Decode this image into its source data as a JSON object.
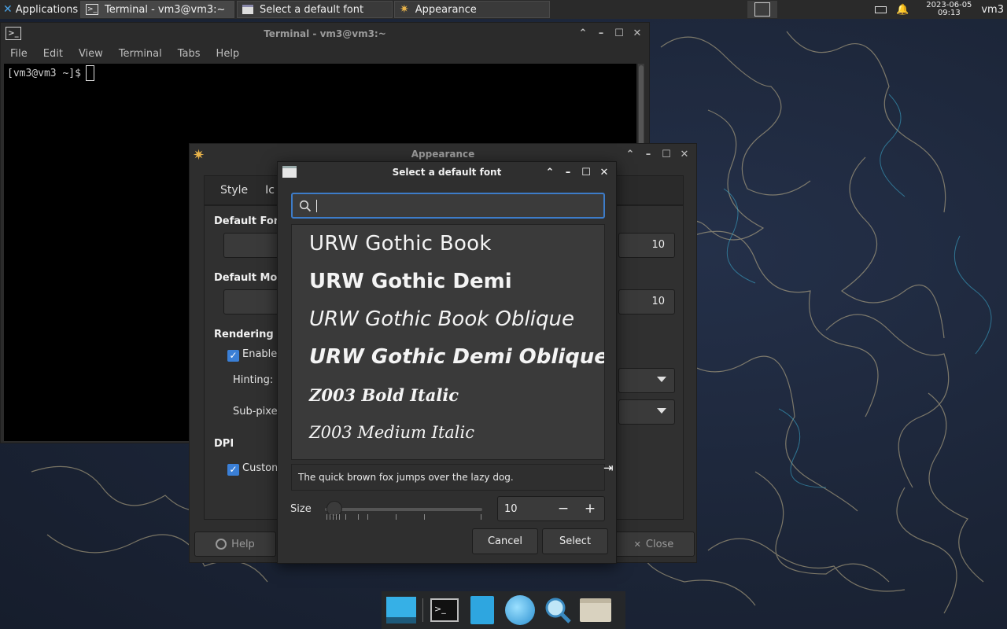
{
  "panel": {
    "applications_label": "Applications",
    "tasks": [
      {
        "label": "Terminal - vm3@vm3:~"
      },
      {
        "label": "Select a default font"
      },
      {
        "label": "Appearance"
      }
    ],
    "clock_date": "2023-06-05",
    "clock_time": "09:13",
    "user": "vm3"
  },
  "terminal": {
    "title": "Terminal - vm3@vm3:~",
    "menu": [
      "File",
      "Edit",
      "View",
      "Terminal",
      "Tabs",
      "Help"
    ],
    "prompt": "[vm3@vm3 ~]$"
  },
  "appearance": {
    "title": "Appearance",
    "tabs": [
      "Style",
      "Ic"
    ],
    "default_font_label": "Default Font",
    "default_font_size": "10",
    "default_mono_label": "Default Mono",
    "default_mono_size": "10",
    "rendering_label": "Rendering",
    "enable_label": "Enable a",
    "hinting_label": "Hinting:",
    "subpixel_label": "Sub-pixel",
    "dpi_label": "DPI",
    "custom_label": "Custom",
    "help_label": "Help",
    "close_label": "Close"
  },
  "font_dialog": {
    "title": "Select a default font",
    "search_value": "",
    "fonts": [
      "URW Gothic Book",
      "URW Gothic Demi",
      "URW Gothic Book Oblique",
      "URW Gothic Demi Oblique",
      "Z003 Bold Italic",
      "Z003 Medium Italic"
    ],
    "preview_text": "The quick brown fox jumps over the lazy dog.",
    "size_label": "Size",
    "size_value": "10",
    "size_slider_value": 10,
    "minus": "−",
    "plus": "+",
    "cancel_label": "Cancel",
    "select_label": "Select"
  },
  "colors": {
    "accent": "#3d7cc9",
    "window_bg": "#2f2f2f",
    "terminal_bg": "#000000"
  },
  "icons": {
    "dock": [
      "desktop-icon",
      "terminal-icon",
      "file-manager-icon",
      "web-browser-icon",
      "search-icon",
      "folder-icon"
    ]
  }
}
